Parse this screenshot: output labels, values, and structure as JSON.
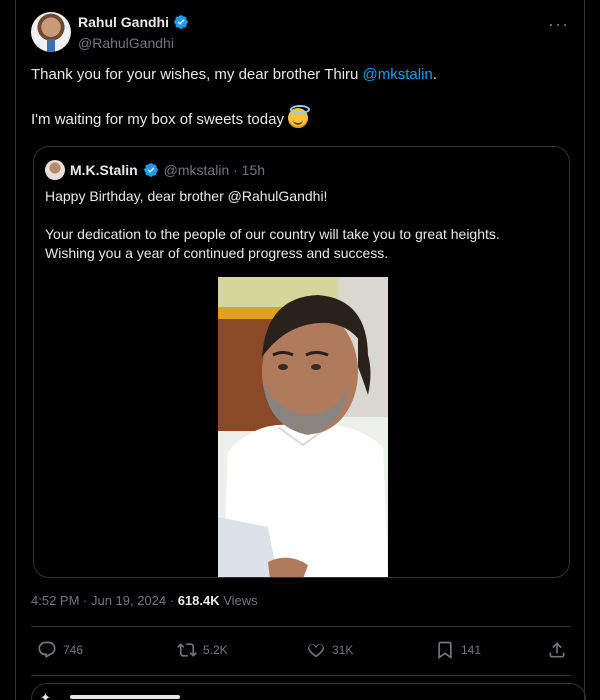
{
  "tweet": {
    "author": {
      "name": "Rahul Gandhi",
      "handle": "@RahulGandhi",
      "verified": true
    },
    "text": {
      "line1_before": "Thank you for your wishes, my dear brother Thiru ",
      "line1_mention": "@mkstalin",
      "line1_after": ".",
      "line2": "I'm waiting for my box of sweets today"
    },
    "more_label": "···",
    "quoted": {
      "name": "M.K.Stalin",
      "handle_time": "@mkstalin · 15h",
      "line1": "Happy Birthday, dear brother @RahulGandhi!",
      "line2": "Your dedication to the people of our country will take you to great heights.",
      "line3": "Wishing you a year of continued progress and success."
    },
    "meta": {
      "timestamp": "4:52 PM · Jun 19, 2024 · ",
      "views_count": "618.4K",
      "views_label": " Views"
    },
    "actions": {
      "replies": "746",
      "reposts": "5.2K",
      "likes": "31K",
      "bookmarks": "141"
    }
  },
  "colors": {
    "accent": "#1d9bf0",
    "background": "#000000",
    "muted": "#71767b",
    "border": "#2f3336"
  }
}
